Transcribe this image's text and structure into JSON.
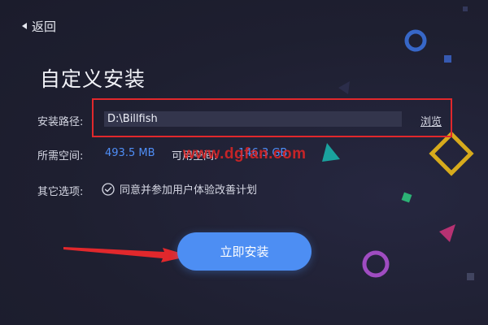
{
  "nav": {
    "back_label": "返回"
  },
  "page": {
    "title": "自定义安装"
  },
  "install_path": {
    "label": "安装路径:",
    "value": "D:\\Billfish",
    "browse_label": "浏览"
  },
  "space": {
    "required_label": "所需空间:",
    "required_value": "493.5 MB",
    "available_label": "可用空间:",
    "available_value": "146.3 GB"
  },
  "options": {
    "label": "其它选项:",
    "agree_text": "同意并参加用户体验改善计划",
    "agree_checked": true
  },
  "install_button": {
    "label": "立即安装"
  },
  "watermark": {
    "text": "www.dgfan.com"
  },
  "colors": {
    "background": "#1f2032",
    "accent": "#4d8ef3",
    "value_blue": "#4f8ef7",
    "highlight_red": "#e1282c"
  },
  "icons": {
    "back": "chevron-left-icon",
    "agree": "check-circle-icon",
    "annotation": "red-arrow-icon"
  }
}
